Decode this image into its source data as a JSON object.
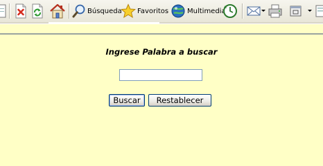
{
  "toolbar": {
    "items": [
      {
        "icon": "page-icon"
      },
      {
        "icon": "stop-icon",
        "color": "#d42b1e"
      },
      {
        "icon": "refresh-icon",
        "color": "#2f9a33"
      },
      {
        "icon": "home-icon"
      },
      {
        "icon": "search-icon",
        "label": "Búsqueda"
      },
      {
        "icon": "favorites-star-icon",
        "label": "Favoritos"
      },
      {
        "icon": "media-icon",
        "label": "Multimedia"
      },
      {
        "icon": "history-icon"
      },
      {
        "icon": "mail-icon"
      },
      {
        "icon": "print-icon"
      },
      {
        "icon": "edit-icon"
      },
      {
        "icon": "more-icon"
      }
    ]
  },
  "form": {
    "title": "Ingrese Palabra a buscar",
    "search_value": "",
    "submit_label": "Buscar",
    "reset_label": "Restablecer"
  }
}
